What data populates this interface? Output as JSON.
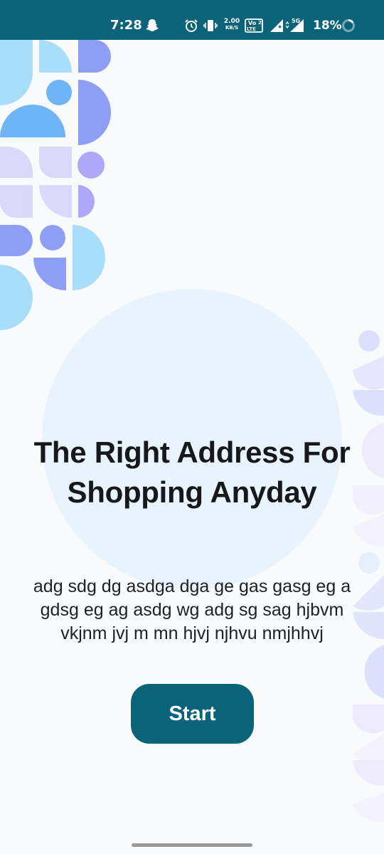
{
  "status_bar": {
    "time": "7:28",
    "network_speed_value": "2.00",
    "network_speed_unit": "KB/S",
    "volte_label_top": "Vo",
    "volte_label_bottom": "LTE",
    "sim_number": "2",
    "network_type": "5G",
    "battery_percent": "18%",
    "icons": [
      "snapchat-icon",
      "alarm-icon",
      "vibrate-icon",
      "network-speed-icon",
      "volte-icon",
      "signal-icon",
      "signal-5g-icon",
      "battery-ring-icon"
    ]
  },
  "main": {
    "title": "The Right Address For Shopping Anyday",
    "description": "adg sdg dg asdga dga ge gas gasg eg a gdsg eg ag asdg wg adg sg sag hjbvm vkjnm jvj m mn hjvj njhvu nmjhhvj",
    "start_label": "Start"
  },
  "colors": {
    "primary": "#0A6379",
    "background": "#F9FAFC",
    "circle": "#E8F4FD",
    "deco_blue": "#A8DEF9",
    "deco_indigo": "#8E9EF5",
    "deco_lavender": "#DCD8FB",
    "deco_purple": "#AFA8F8"
  }
}
